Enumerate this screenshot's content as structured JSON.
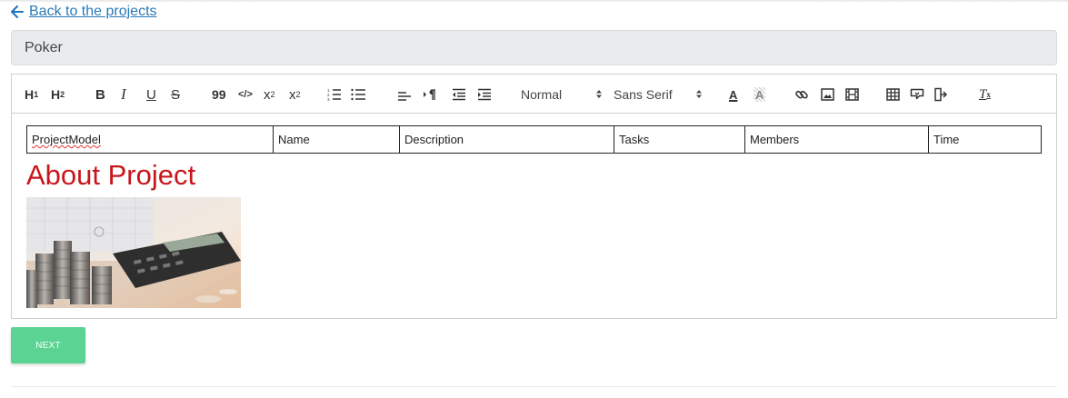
{
  "nav": {
    "back_label": "Back to the projects"
  },
  "project": {
    "title": "Poker"
  },
  "toolbar": {
    "header1": "H",
    "header1_sub": "1",
    "header2": "H",
    "header2_sub": "2",
    "bold": "B",
    "italic": "I",
    "underline": "U",
    "strike": "S",
    "blockquote": "99",
    "code": "</>",
    "subscript": "x",
    "subscript_mark": "2",
    "superscript": "x",
    "superscript_mark": "2",
    "size_value": "Normal",
    "font_value": "Sans Serif",
    "color_letter": "A",
    "background_letter": "A",
    "clean_letter": "T",
    "clean_mark": "x"
  },
  "document": {
    "columns": [
      "ProjectModel",
      "Name",
      "Description",
      "Tasks",
      "Members",
      "Time"
    ],
    "heading": "About Project",
    "heading_color": "#c8161d",
    "image_description": "coins stacks and calculator"
  },
  "actions": {
    "next_label": "NEXT",
    "next_color": "#5bd392"
  }
}
